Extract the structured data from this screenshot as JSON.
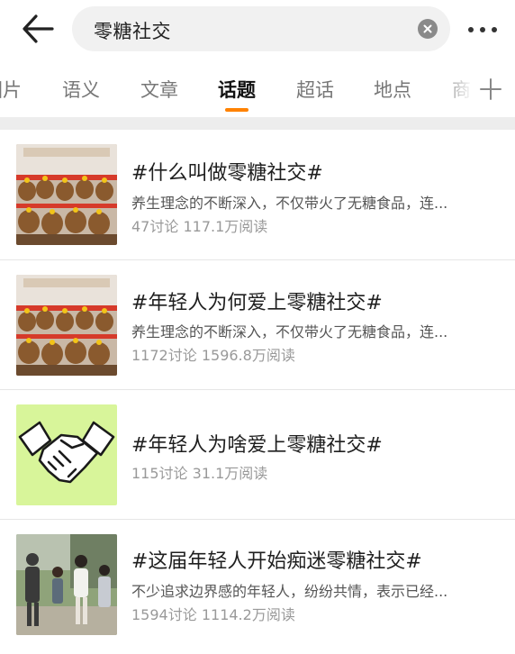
{
  "search": {
    "query": "零糖社交"
  },
  "tabs": [
    {
      "label": "图片"
    },
    {
      "label": "语义"
    },
    {
      "label": "文章"
    },
    {
      "label": "话题",
      "active": true
    },
    {
      "label": "超话"
    },
    {
      "label": "地点"
    },
    {
      "label": "商"
    }
  ],
  "colors": {
    "accent": "#ff8200",
    "handshake_bg": "#d8f59a"
  },
  "results": [
    {
      "title": "#什么叫做零糖社交#",
      "description": "养生理念的不断深入，不仅带火了无糖食品，连...",
      "discussions": "47讨论",
      "reads": "117.1万阅读",
      "thumbnail": "plush-toy-display-image"
    },
    {
      "title": "#年轻人为何爱上零糖社交#",
      "description": "养生理念的不断深入，不仅带火了无糖食品，连...",
      "discussions": "1172讨论",
      "reads": "1596.8万阅读",
      "thumbnail": "plush-toy-display-image"
    },
    {
      "title": "#年轻人为啥爱上零糖社交#",
      "description": "",
      "discussions": "115讨论",
      "reads": "31.1万阅读",
      "thumbnail": "handshake-icon"
    },
    {
      "title": "#这届年轻人开始痴迷零糖社交#",
      "description": "不少追求边界感的年轻人，纷纷共情，表示已经...",
      "discussions": "1594讨论",
      "reads": "1114.2万阅读",
      "thumbnail": "people-photo-image"
    }
  ]
}
